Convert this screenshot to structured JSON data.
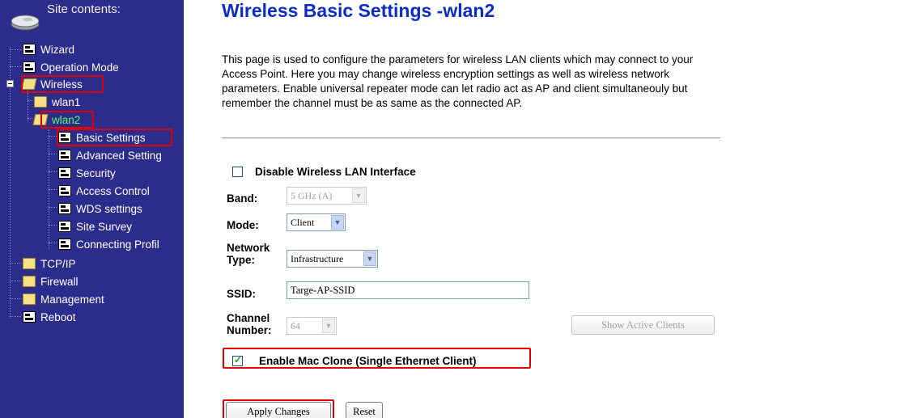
{
  "sidebar": {
    "header": "Site contents:",
    "items": {
      "wizard": "Wizard",
      "operation_mode": "Operation Mode",
      "wireless": "Wireless",
      "wlan1": "wlan1",
      "wlan2": "wlan2",
      "basic_settings": "Basic Settings",
      "advanced_settings": "Advanced Setting",
      "security": "Security",
      "access_control": "Access Control",
      "wds_settings": "WDS settings",
      "site_survey": "Site Survey",
      "connecting_profile": "Connecting Profil",
      "tcpip": "TCP/IP",
      "firewall": "Firewall",
      "management": "Management",
      "reboot": "Reboot"
    }
  },
  "page": {
    "title": "Wireless Basic Settings -wlan2",
    "description": "This page is used to configure the parameters for wireless LAN clients which may connect to your Access Point. Here you may change wireless encryption settings as well as wireless network parameters. Enable universal repeater mode can let radio act as AP and client simultaneouly but remember the channel must be as same as the connected AP."
  },
  "form": {
    "disable_wlan_label": "Disable Wireless LAN Interface",
    "disable_wlan_checked": false,
    "band_label": "Band:",
    "band_value": "5 GHz (A)",
    "mode_label": "Mode:",
    "mode_value": "Client",
    "network_type_label_1": "Network",
    "network_type_label_2": "Type:",
    "network_type_value": "Infrastructure",
    "ssid_label": "SSID:",
    "ssid_value": "Targe-AP-SSID",
    "channel_label_1": "Channel",
    "channel_label_2": "Number:",
    "channel_value": "64",
    "show_clients_button": "Show Active Clients",
    "mac_clone_label": "Enable Mac Clone (Single Ethernet Client)",
    "mac_clone_checked": true,
    "apply_button": "Apply Changes",
    "reset_button": "Reset"
  },
  "colors": {
    "sidebar_bg": "#2c2c8c",
    "title": "#0a2cc8",
    "highlight": "#e00000",
    "active_item": "#5aff5a"
  }
}
